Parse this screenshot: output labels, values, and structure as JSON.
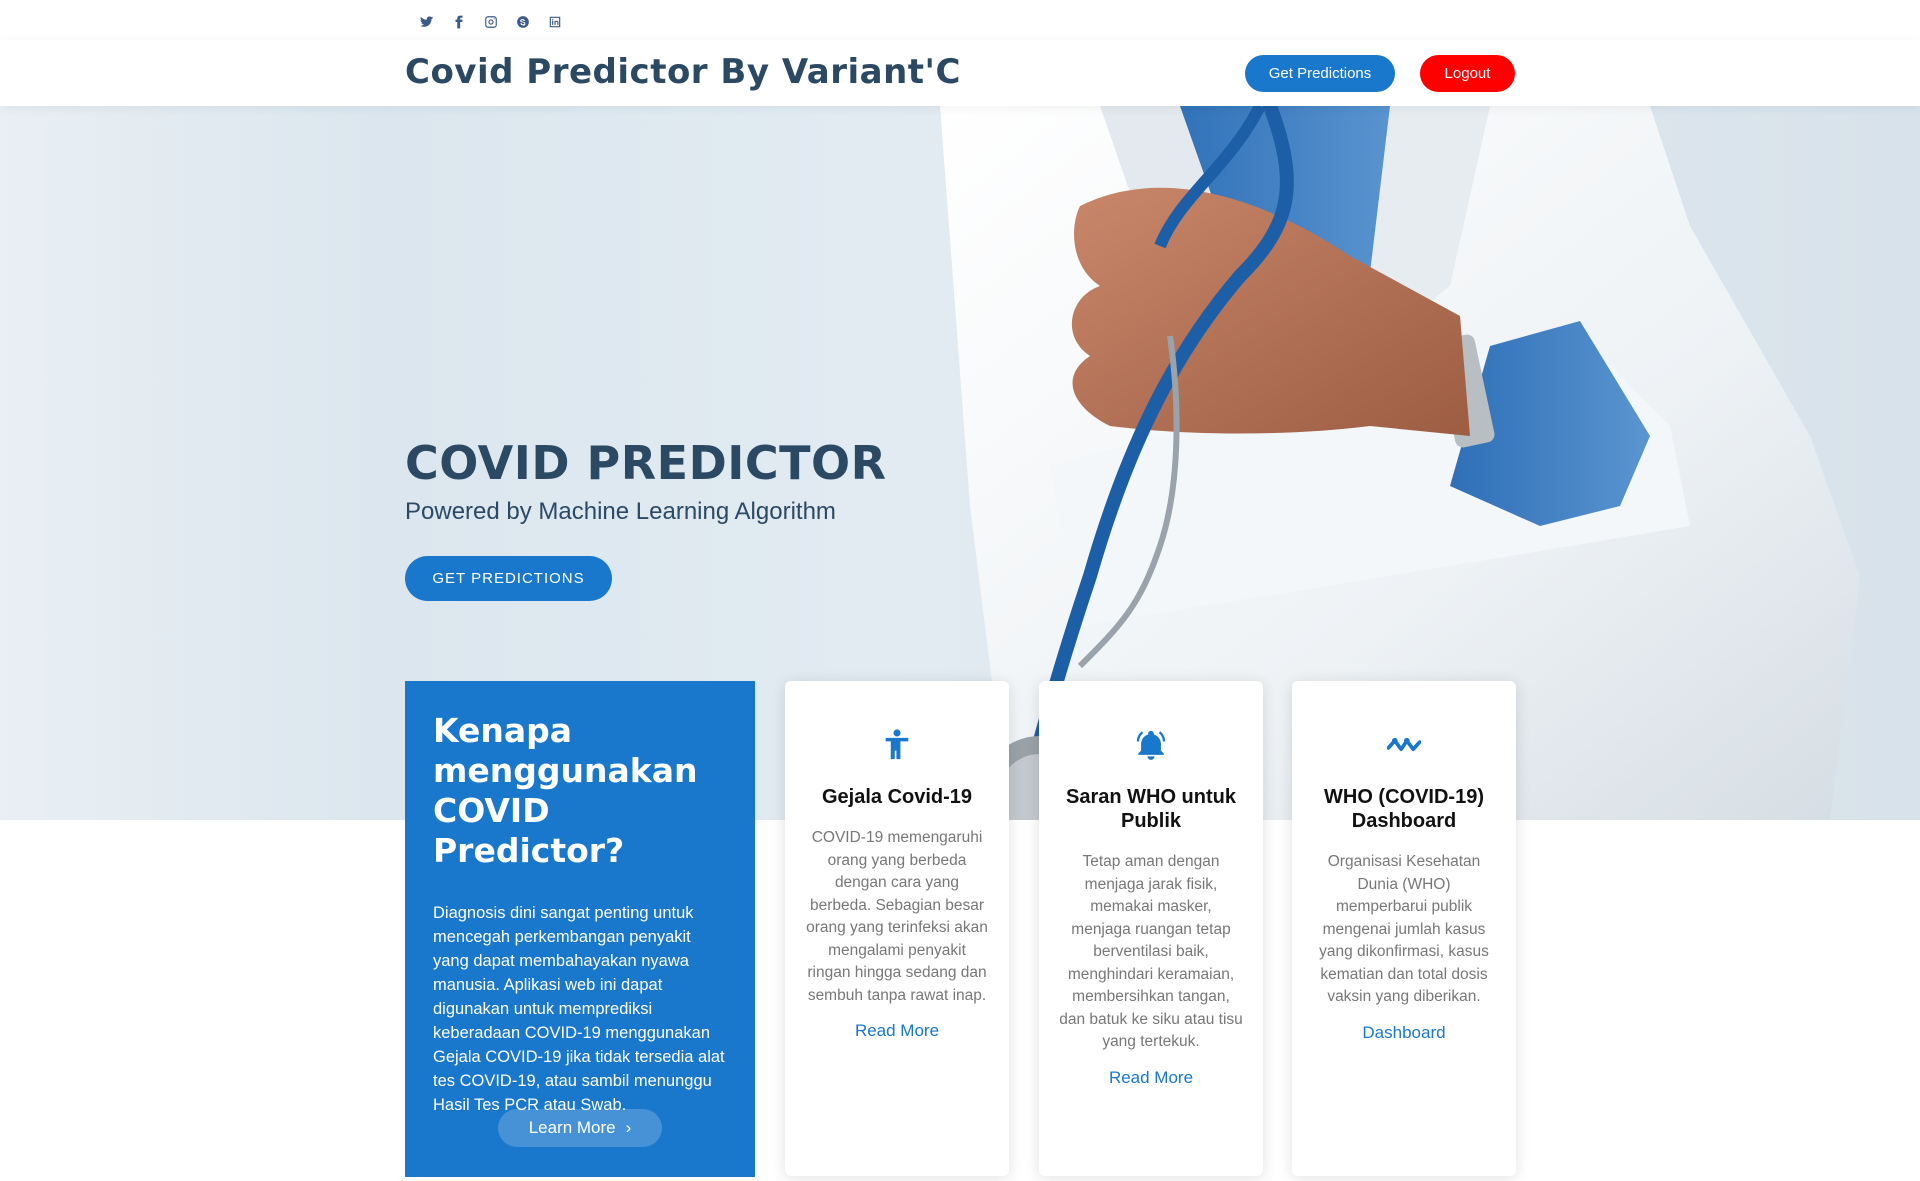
{
  "social": [
    "twitter-icon",
    "facebook-icon",
    "instagram-icon",
    "skype-icon",
    "linkedin-icon"
  ],
  "header": {
    "logo": "Covid Predictor By Variant'C",
    "predict_label": "Get Predictions",
    "logout_label": "Logout"
  },
  "hero": {
    "title": "COVID PREDICTOR",
    "subtitle": "Powered by Machine Learning Algorithm",
    "cta_label": "GET PREDICTIONS"
  },
  "why": {
    "title": "Kenapa menggunakan COVID Predictor?",
    "text": "Diagnosis dini sangat penting untuk mencegah perkembangan penyakit yang dapat membahayakan nyawa manusia. Aplikasi web ini dapat digunakan untuk memprediksi keberadaan COVID-19 menggunakan Gejala COVID-19 jika tidak tersedia alat tes COVID-19, atau sambil menunggu Hasil Tes PCR atau Swab.",
    "button_label": "Learn More"
  },
  "cards": [
    {
      "icon": "person-icon",
      "title": "Gejala Covid-19",
      "text": "COVID-19 memengaruhi orang yang berbeda dengan cara yang berbeda. Sebagian besar orang yang terinfeksi akan mengalami penyakit ringan hingga sedang dan sembuh tanpa rawat inap.",
      "link": "Read More"
    },
    {
      "icon": "bell-icon",
      "title": "Saran WHO untuk Publik",
      "text": "Tetap aman dengan menjaga jarak fisik, memakai masker, menjaga ruangan tetap berventilasi baik, menghindari keramaian, membersihkan tangan, dan batuk ke siku atau tisu yang tertekuk.",
      "link": "Read More"
    },
    {
      "icon": "activity-icon",
      "title": "WHO (COVID-19) Dashboard",
      "text": "Organisasi Kesehatan Dunia (WHO) memperbarui publik mengenai jumlah kasus yang dikonfirmasi, kasus kematian dan total dosis vaksin yang diberikan.",
      "link": "Dashboard"
    }
  ],
  "colors": {
    "primary": "#1977cc",
    "heading": "#2c4964",
    "logout": "#ff0000"
  }
}
